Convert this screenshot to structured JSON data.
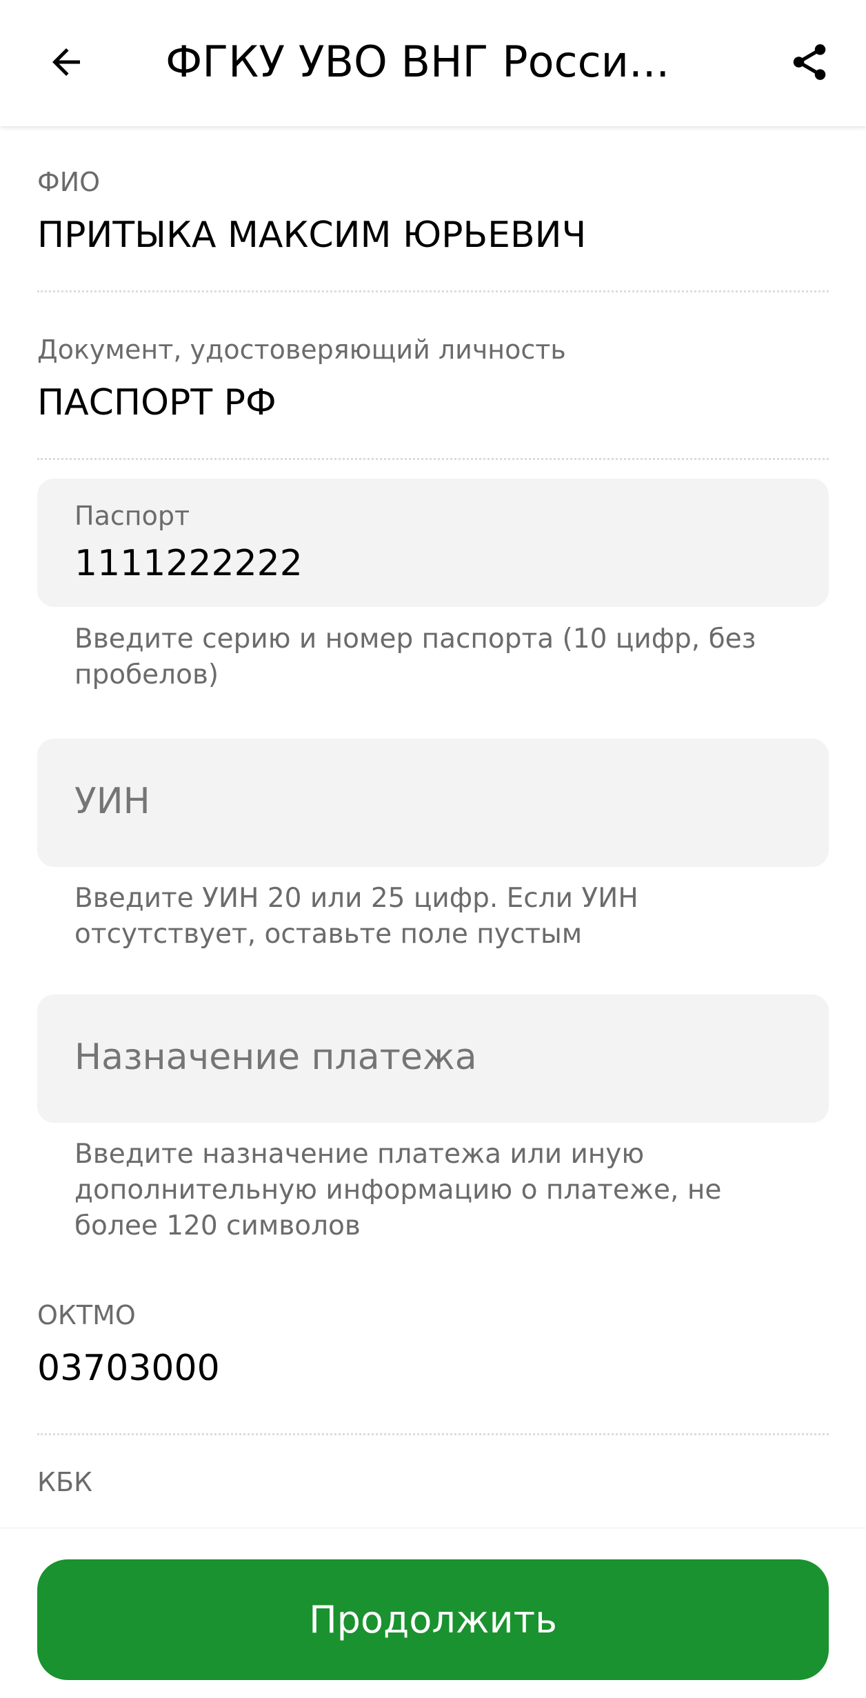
{
  "header": {
    "title": "ФГКУ УВО ВНГ Росси...",
    "back_icon": "arrow-left-icon",
    "share_icon": "share-icon"
  },
  "fields": {
    "fio": {
      "label": "ФИО",
      "value": "ПРИТЫКА МАКСИМ ЮРЬЕВИЧ"
    },
    "document": {
      "label": "Документ, удостоверяющий личность",
      "value": "ПАСПОРТ РФ"
    },
    "passport": {
      "label": "Паспорт",
      "value": "1111222222",
      "hint": "Введите серию и номер паспорта (10 цифр, без пробелов)"
    },
    "uin": {
      "placeholder": "УИН",
      "value": "",
      "hint": "Введите УИН 20 или 25 цифр. Если УИН отсутствует, оставьте поле пустым"
    },
    "purpose": {
      "placeholder": "Назначение платежа",
      "value": "",
      "hint": "Введите назначение платежа или иную дополнительную информацию о платеже, не более 120 символов"
    },
    "oktmo": {
      "label": "ОКТМО",
      "value": "03703000"
    },
    "kbk": {
      "label": "КБК"
    }
  },
  "footer": {
    "continue_label": "Продолжить"
  },
  "colors": {
    "accent_green": "#1a922f",
    "input_bg": "#f3f3f3",
    "label_gray": "#6b6b6b"
  }
}
